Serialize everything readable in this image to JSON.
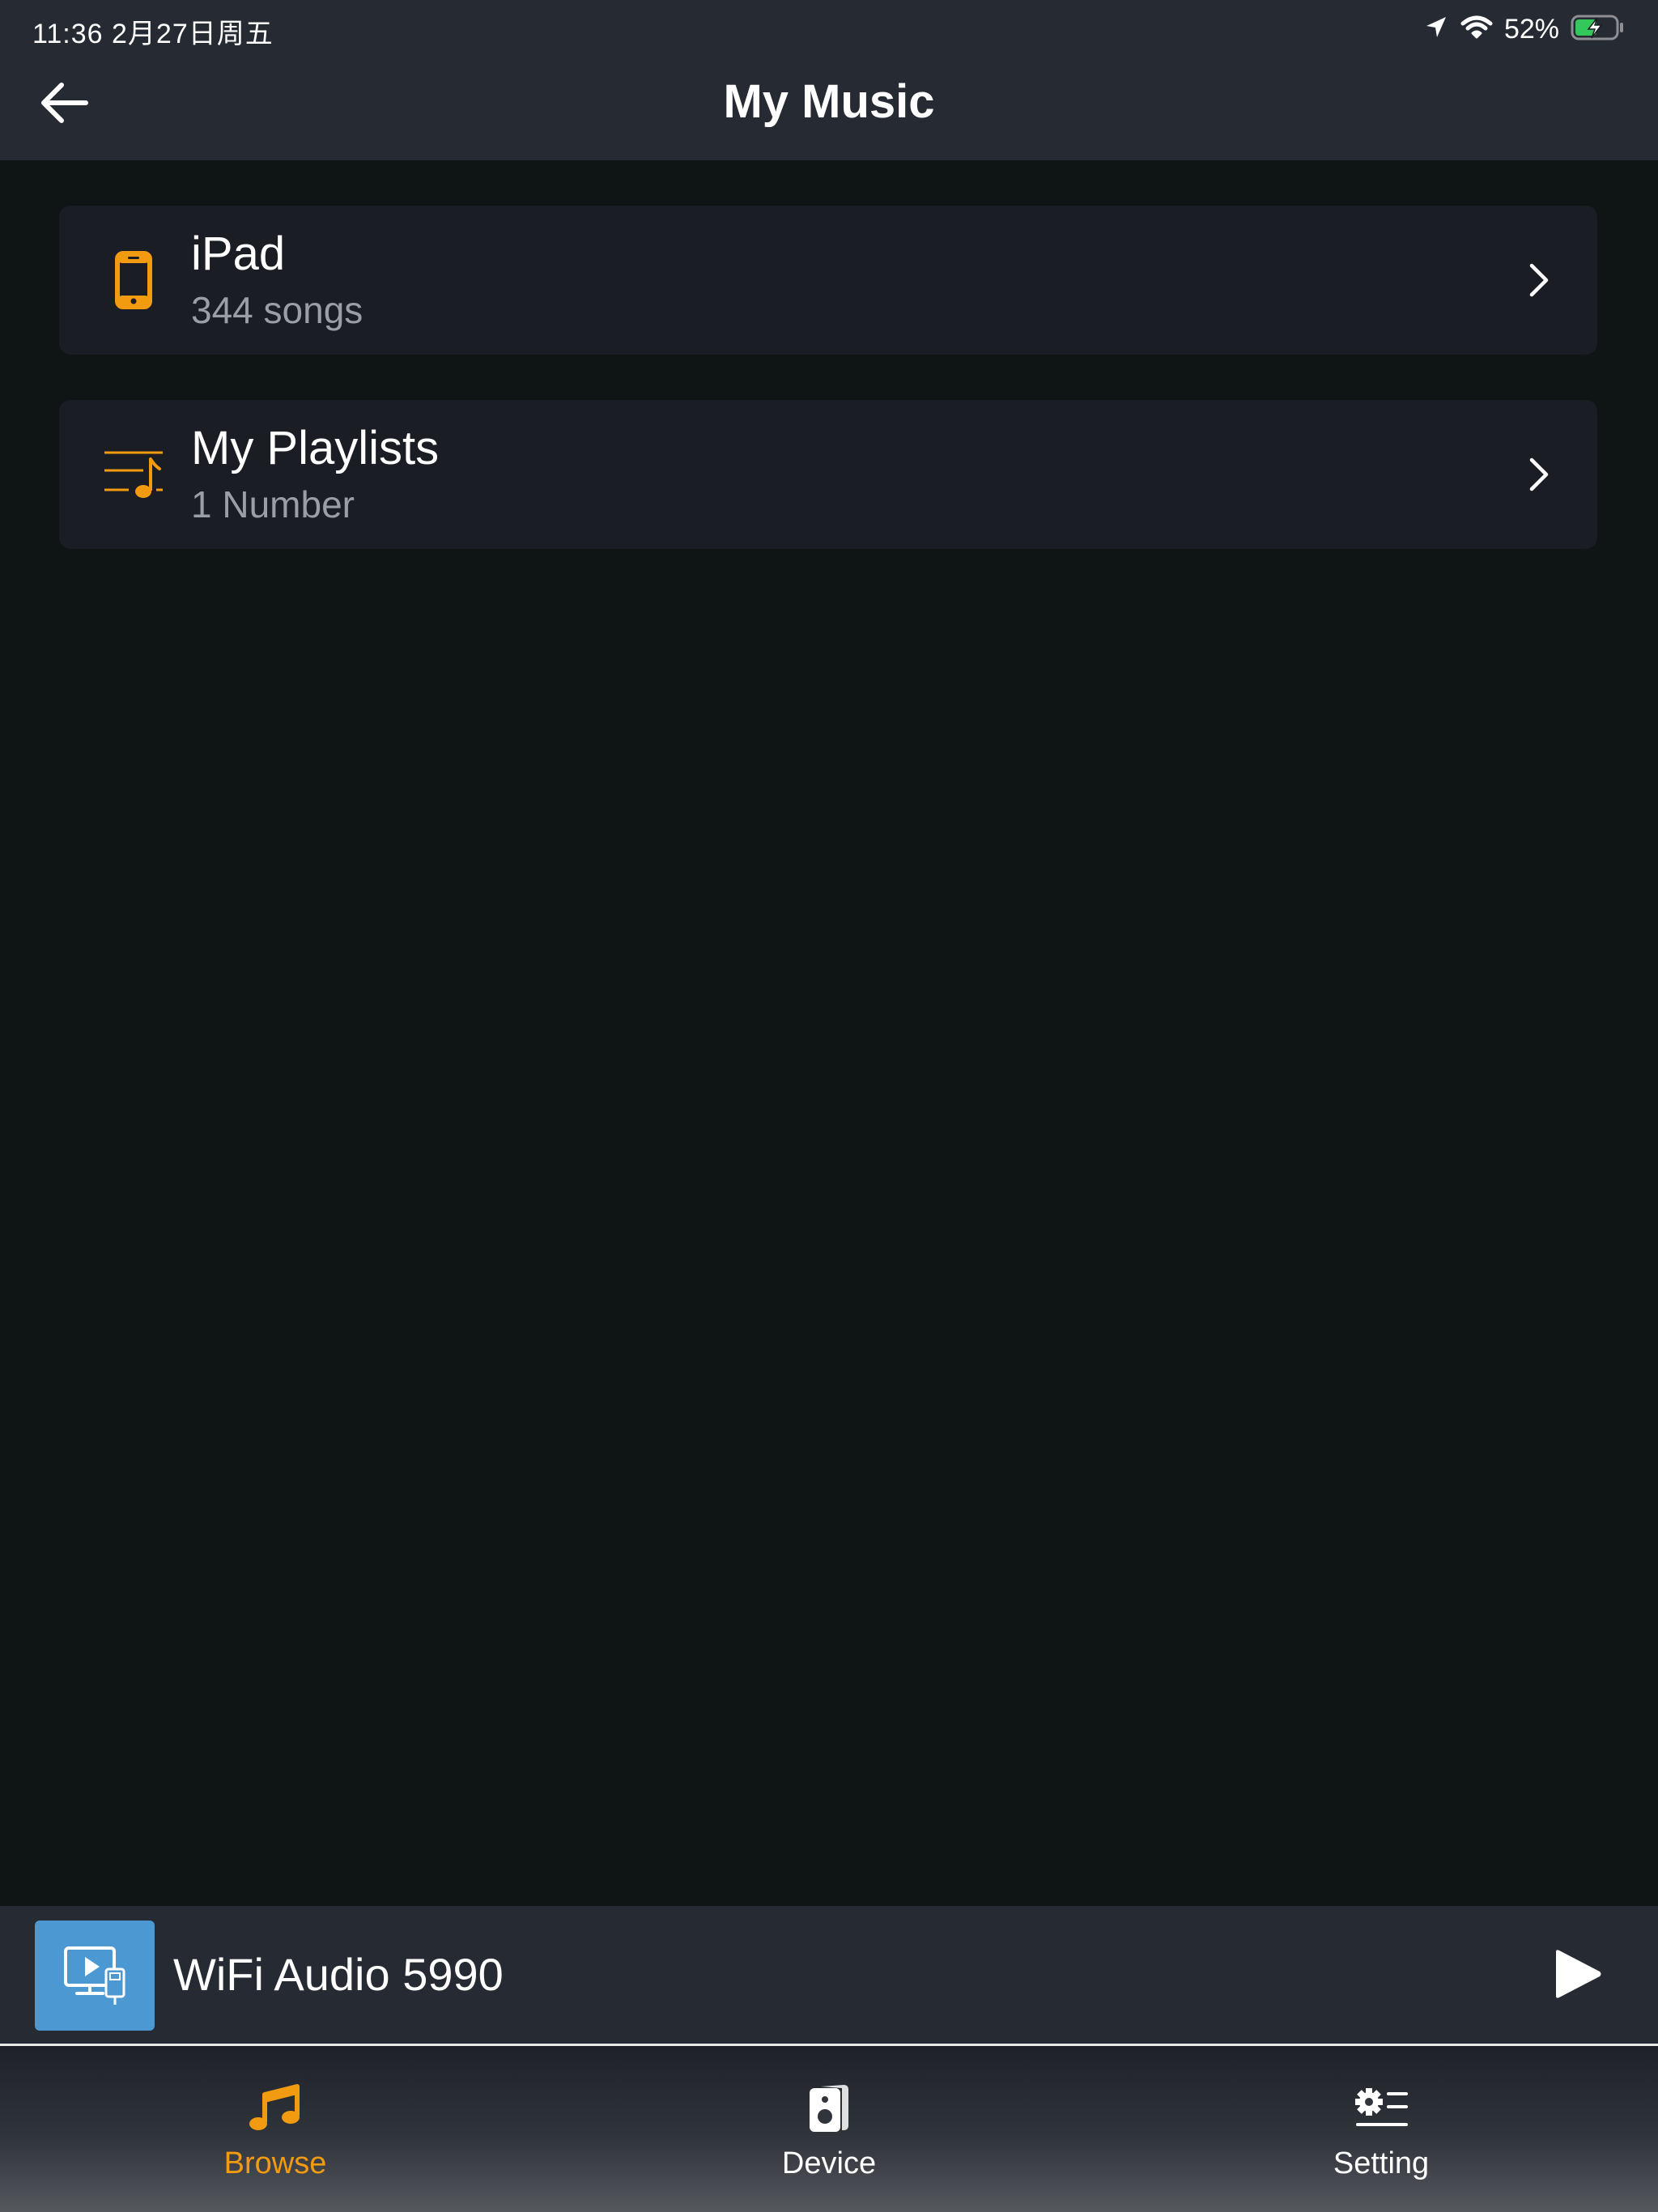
{
  "status_bar": {
    "time": "11:36   2月27日周五",
    "battery_percent": "52%",
    "battery_level": 0.52,
    "charging": true
  },
  "nav": {
    "title": "My Music",
    "back_icon": "arrow-left-icon"
  },
  "items": [
    {
      "title": "iPad",
      "subtitle": "344 songs",
      "icon": "phone-icon"
    },
    {
      "title": "My Playlists",
      "subtitle": "1 Number",
      "icon": "playlist-icon"
    }
  ],
  "now_playing": {
    "title": "WiFi Audio 5990",
    "art_icon": "media-device-icon",
    "play_icon": "play-icon"
  },
  "tabs": [
    {
      "label": "Browse",
      "icon": "music-note-icon",
      "active": true
    },
    {
      "label": "Device",
      "icon": "speaker-icon",
      "active": false
    },
    {
      "label": "Setting",
      "icon": "settings-icon",
      "active": false
    }
  ],
  "colors": {
    "accent": "#f29b11",
    "background": "#0f1415",
    "header": "#252a33",
    "card": "#1a1d24",
    "secondary_text": "#9a9ea6",
    "art_background": "#4b98d3",
    "battery_charge": "#34c759"
  }
}
